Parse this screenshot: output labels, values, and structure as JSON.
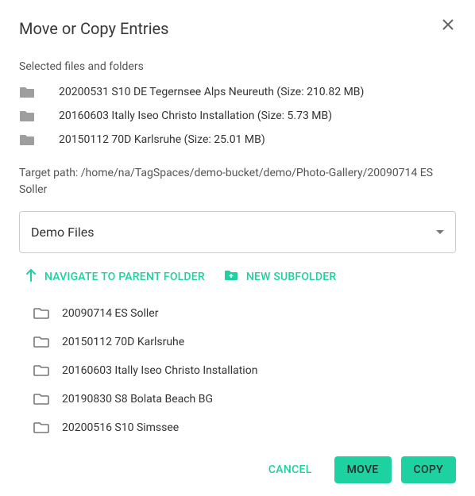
{
  "dialog": {
    "title": "Move or Copy Entries",
    "section_label": "Selected files and folders",
    "selected": [
      "20200531 S10 DE Tegernsee Alps Neureuth (Size: 210.82 MB)",
      "20160603 Itally Iseo Christo Installation (Size: 5.73 MB)",
      "20150112 70D Karlsruhe (Size: 25.01 MB)"
    ],
    "target_path_label": "Target path: ",
    "target_path": "/home/na/TagSpaces/demo-bucket/demo/Photo-Gallery/20090714 ES Soller",
    "location_select": "Demo Files",
    "nav_parent": "NAVIGATE TO PARENT FOLDER",
    "new_subfolder": "NEW SUBFOLDER",
    "folders": [
      "20090714 ES Soller",
      "20150112 70D Karlsruhe",
      "20160603 Itally Iseo Christo Installation",
      "20190830 S8 Bolata Beach BG",
      "20200516 S10 Simssee"
    ],
    "buttons": {
      "cancel": "CANCEL",
      "move": "MOVE",
      "copy": "COPY"
    }
  }
}
